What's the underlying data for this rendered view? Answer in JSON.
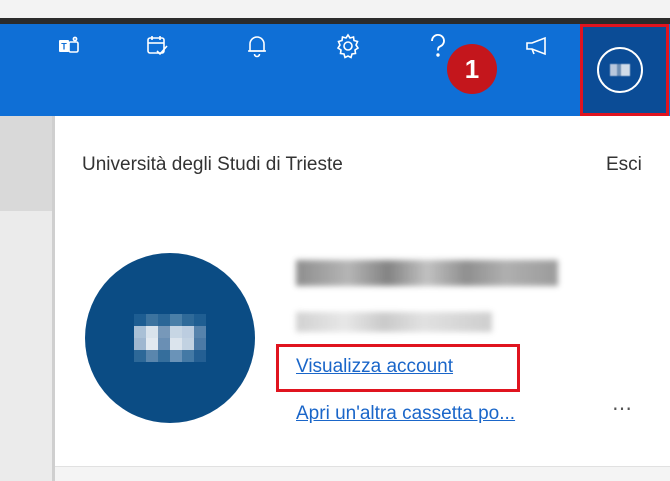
{
  "header": {
    "icons": [
      {
        "name": "teams-icon"
      },
      {
        "name": "calendar-check-icon"
      },
      {
        "name": "bell-icon"
      },
      {
        "name": "gear-icon"
      },
      {
        "name": "help-icon"
      },
      {
        "name": "megaphone-icon"
      }
    ],
    "badge_number": "1"
  },
  "account_panel": {
    "organization": "Università degli Studi di Trieste",
    "sign_out": "Esci",
    "view_account": "Visualizza account",
    "open_mailbox": "Apri un'altra cassetta po...",
    "more": "⋯"
  },
  "colors": {
    "app_bar": "#0f6fd6",
    "highlight": "#e0141f",
    "avatar": "#0b4c84",
    "link": "#1a66c9",
    "badge": "#c4161c"
  }
}
